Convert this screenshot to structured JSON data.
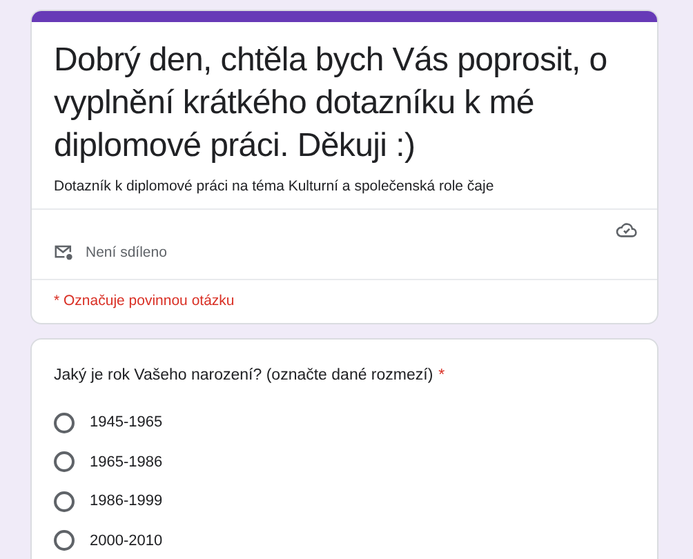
{
  "header": {
    "title": "Dobrý den, chtěla bych Vás poprosit, o vyplnění krátkého dotazníku k mé diplomové práci. Děkuji :)",
    "description": "Dotazník k diplomové práci na téma Kulturní a společenská role čaje",
    "sharing": "Není sdíleno",
    "required_note": "* Označuje povinnou otázku"
  },
  "question": {
    "text": "Jaký je rok Vašeho narození? (označte dané rozmezí)",
    "required_mark": "*",
    "options": [
      {
        "label": "1945-1965",
        "selected": false
      },
      {
        "label": "1965-1986",
        "selected": false
      },
      {
        "label": "1986-1999",
        "selected": false
      },
      {
        "label": "2000-2010",
        "selected": false
      }
    ]
  }
}
